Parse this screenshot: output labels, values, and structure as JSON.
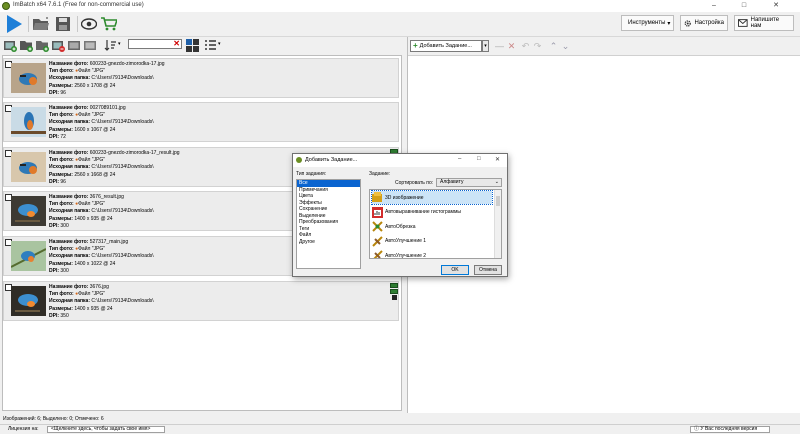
{
  "window": {
    "title": "ImBatch x64 7.6.1 (Free for non-commercial use)"
  },
  "toolbar": {
    "tools_label": "Инструменты",
    "settings_label": "Настройка",
    "contact_label": "Напишите нам"
  },
  "left_panel": {
    "search_value": "",
    "images": [
      {
        "name_label": "Название фото:",
        "name": "600233-gnezdo-zimorodka-17.jpg",
        "type_label": "Тип фото:",
        "type": "Файл \"JPG\"",
        "folder_label": "Исходная папка:",
        "folder": "C:\\Users\\79134\\Downloads\\",
        "size_label": "Размеры:",
        "size": "2560 x 1708 @ 24",
        "dpi_label": "DPI:",
        "dpi": "96",
        "badge": false
      },
      {
        "name_label": "Название фото:",
        "name": "0027089101.jpg",
        "type_label": "Тип фото:",
        "type": "Файл \"JPG\"",
        "folder_label": "Исходная папка:",
        "folder": "C:\\Users\\79134\\Downloads\\",
        "size_label": "Размеры:",
        "size": "1600 x 1067 @ 24",
        "dpi_label": "DPI:",
        "dpi": "72",
        "badge": false
      },
      {
        "name_label": "Название фото:",
        "name": "600233-gnezdo-zimorodka-17_result.jpg",
        "type_label": "Тип фото:",
        "type": "Файл \"JPG\"",
        "folder_label": "Исходная папка:",
        "folder": "C:\\Users\\79134\\Downloads\\",
        "size_label": "Размеры:",
        "size": "2560 x 1668 @ 24",
        "dpi_label": "DPI:",
        "dpi": "96",
        "badge": true
      },
      {
        "name_label": "Название фото:",
        "name": "3676_result.jpg",
        "type_label": "Тип фото:",
        "type": "Файл \"JPG\"",
        "folder_label": "Исходная папка:",
        "folder": "C:\\Users\\79134\\Downloads\\",
        "size_label": "Размеры:",
        "size": "1400 x 935 @ 24",
        "dpi_label": "DPI:",
        "dpi": "300",
        "badge": false
      },
      {
        "name_label": "Название фото:",
        "name": "527317_main.jpg",
        "type_label": "Тип фото:",
        "type": "Файл \"JPG\"",
        "folder_label": "Исходная папка:",
        "folder": "C:\\Users\\79134\\Downloads\\",
        "size_label": "Размеры:",
        "size": "1400 x 1022 @ 24",
        "dpi_label": "DPI:",
        "dpi": "300",
        "badge": false
      },
      {
        "name_label": "Название фото:",
        "name": "3676.jpg",
        "type_label": "Тип фото:",
        "type": "Файл \"JPG\"",
        "folder_label": "Исходная папка:",
        "folder": "C:\\Users\\79134\\Downloads\\",
        "size_label": "Размеры:",
        "size": "1400 x 935 @ 24",
        "dpi_label": "DPI:",
        "dpi": "350",
        "badge": true
      }
    ]
  },
  "right_panel": {
    "add_task_label": "Добавить Задание..."
  },
  "status": {
    "counts": "Изображений: 6; Выделено: 0; Отмечено: 6",
    "license_label": "Лицензия на:",
    "license_value": "<Щелкните здесь, чтобы задать свое имя>",
    "version": "У Вас последняя версия"
  },
  "dialog": {
    "title": "Добавить Задание...",
    "type_label": "Тип задания:",
    "task_label": "Задание:",
    "sort_label": "Сортировать по:",
    "sort_value": "Алфавиту",
    "types": [
      "Все",
      "Примечания",
      "Цвета",
      "Эффекты",
      "Сохранение",
      "Выделение",
      "Преобразования",
      "Теги",
      "Файл",
      "Другое"
    ],
    "tasks": [
      "3D изображение",
      "Автовыравнивание гистограммы",
      "АвтоОбрезка",
      "АвтоУлучшение 1",
      "АвтоУлучшение 2"
    ],
    "ok_label": "OK",
    "cancel_label": "Отмена"
  },
  "colors": {
    "accent": "#0a64d0",
    "play": "#1e7fd8",
    "cart": "#2e8b2e",
    "remove": "#d22c2c"
  }
}
